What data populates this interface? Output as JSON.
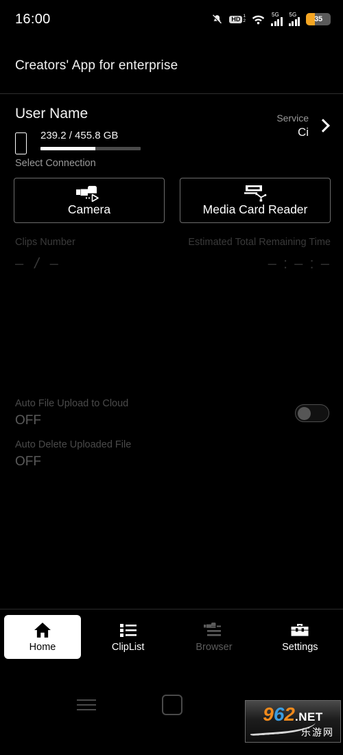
{
  "status_bar": {
    "time": "16:00",
    "icons": [
      {
        "name": "mute-icon",
        "label": "mute"
      },
      {
        "name": "hd-icon",
        "label": "HD",
        "sub_top": "1",
        "sub_bottom": "2"
      },
      {
        "name": "wifi-icon",
        "label": "wifi"
      },
      {
        "name": "signal-icon-1",
        "label": "5G"
      },
      {
        "name": "signal-icon-2",
        "label": "5G"
      }
    ],
    "battery": {
      "percent": "35",
      "fill_ratio": 36,
      "fill_color": "#f5a623"
    }
  },
  "header": {
    "title": "Creators' App for enterprise"
  },
  "account": {
    "user_name": "User Name",
    "device_icon": "phone-icon",
    "storage_text": "239.2 / 455.8 GB",
    "storage_used_percent": 55,
    "service_label": "Service",
    "service_value": "Ci",
    "chevron_icon": "chevron-right-icon"
  },
  "connection": {
    "section_label": "Select Connection",
    "options": [
      {
        "label": "Camera",
        "icon": "camcorder-icon"
      },
      {
        "label": "Media Card Reader",
        "icon": "card-reader-usb-icon"
      }
    ]
  },
  "stats": {
    "clips_label": "Clips Number",
    "clips_value_left": "–",
    "clips_separator": "/",
    "clips_value_right": "–",
    "time_label": "Estimated Total Remaining Time",
    "time_value": "– : – : –"
  },
  "auto_settings": [
    {
      "label": "Auto File Upload to Cloud",
      "value": "OFF",
      "toggle": "off"
    },
    {
      "label": "Auto Delete Uploaded File",
      "value": "OFF"
    }
  ],
  "bottom_nav": [
    {
      "label": "Home",
      "icon": "home-icon",
      "state": "active"
    },
    {
      "label": "ClipList",
      "icon": "list-icon",
      "state": "enabled"
    },
    {
      "label": "Browser",
      "icon": "browser-icon",
      "state": "disabled"
    },
    {
      "label": "Settings",
      "icon": "toolbox-icon",
      "state": "enabled"
    }
  ],
  "system_nav": {
    "recents_icon": "recents-icon",
    "home_icon": "home-square-icon"
  },
  "watermark": {
    "digit_9": "9",
    "digit_6": "6",
    "digit_2": "2",
    "net": ".NET",
    "chinese": "乐游网"
  },
  "colors": {
    "background": "#000000",
    "text_primary": "#f2f2f2",
    "text_secondary": "#9a9a9a",
    "text_disabled": "#3a3a3a",
    "accent_battery": "#f5a623",
    "border": "#6d6d6d"
  }
}
